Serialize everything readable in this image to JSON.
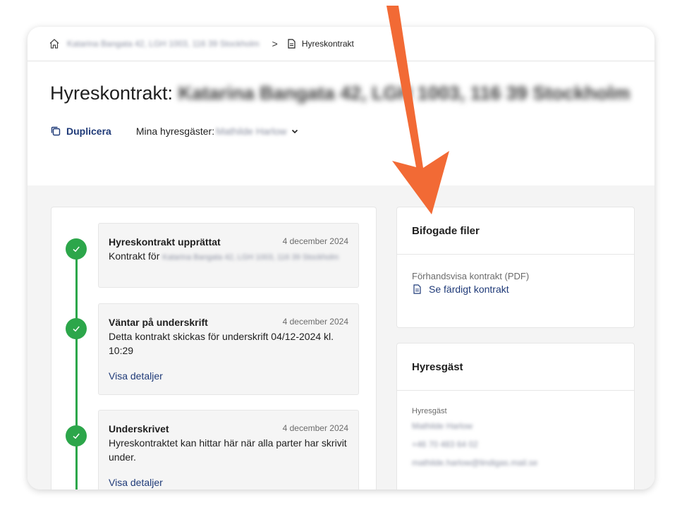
{
  "breadcrumb": {
    "address": "Katarina Bangata 42, LGH 1003, 116 39 Stockholm",
    "current": "Hyreskontrakt"
  },
  "header": {
    "title_prefix": "Hyreskontrakt:",
    "title_address": " Katarina Bangata 42, LGH 1003, 116 39 Stockholm",
    "duplicate_label": "Duplicera",
    "tenants_label": "Mina hyresgäster:",
    "tenants_value": "Mathilde Harlow"
  },
  "timeline": [
    {
      "title": "Hyreskontrakt upprättat",
      "date": "4 december 2024",
      "text": "Kontrakt för",
      "text_blur": "Katarina Bangata 42, LGH 1003, 116 39 Stockholm"
    },
    {
      "title": "Väntar på underskrift",
      "date": "4 december 2024",
      "text": "Detta kontrakt skickas för underskrift 04/12-2024 kl. 10:29",
      "link": "Visa detaljer"
    },
    {
      "title": "Underskrivet",
      "date": "4 december 2024",
      "text": "Hyreskontraktet kan hittar här när alla parter har skrivit under.",
      "link": "Visa detaljer"
    }
  ],
  "files": {
    "heading": "Bifogade filer",
    "preview_label": "Förhandsvisa kontrakt (PDF)",
    "link_label": "Se färdigt kontrakt"
  },
  "tenant": {
    "heading": "Hyresgäst",
    "label": "Hyresgäst",
    "name": "Mathilde Harlow",
    "phone": "+46 70 483 64 02",
    "email": "mathilde.harlow@lindigas.mail.se"
  },
  "colors": {
    "accent": "#1f3a78",
    "success": "#2ca64a",
    "arrow": "#f26a35"
  }
}
